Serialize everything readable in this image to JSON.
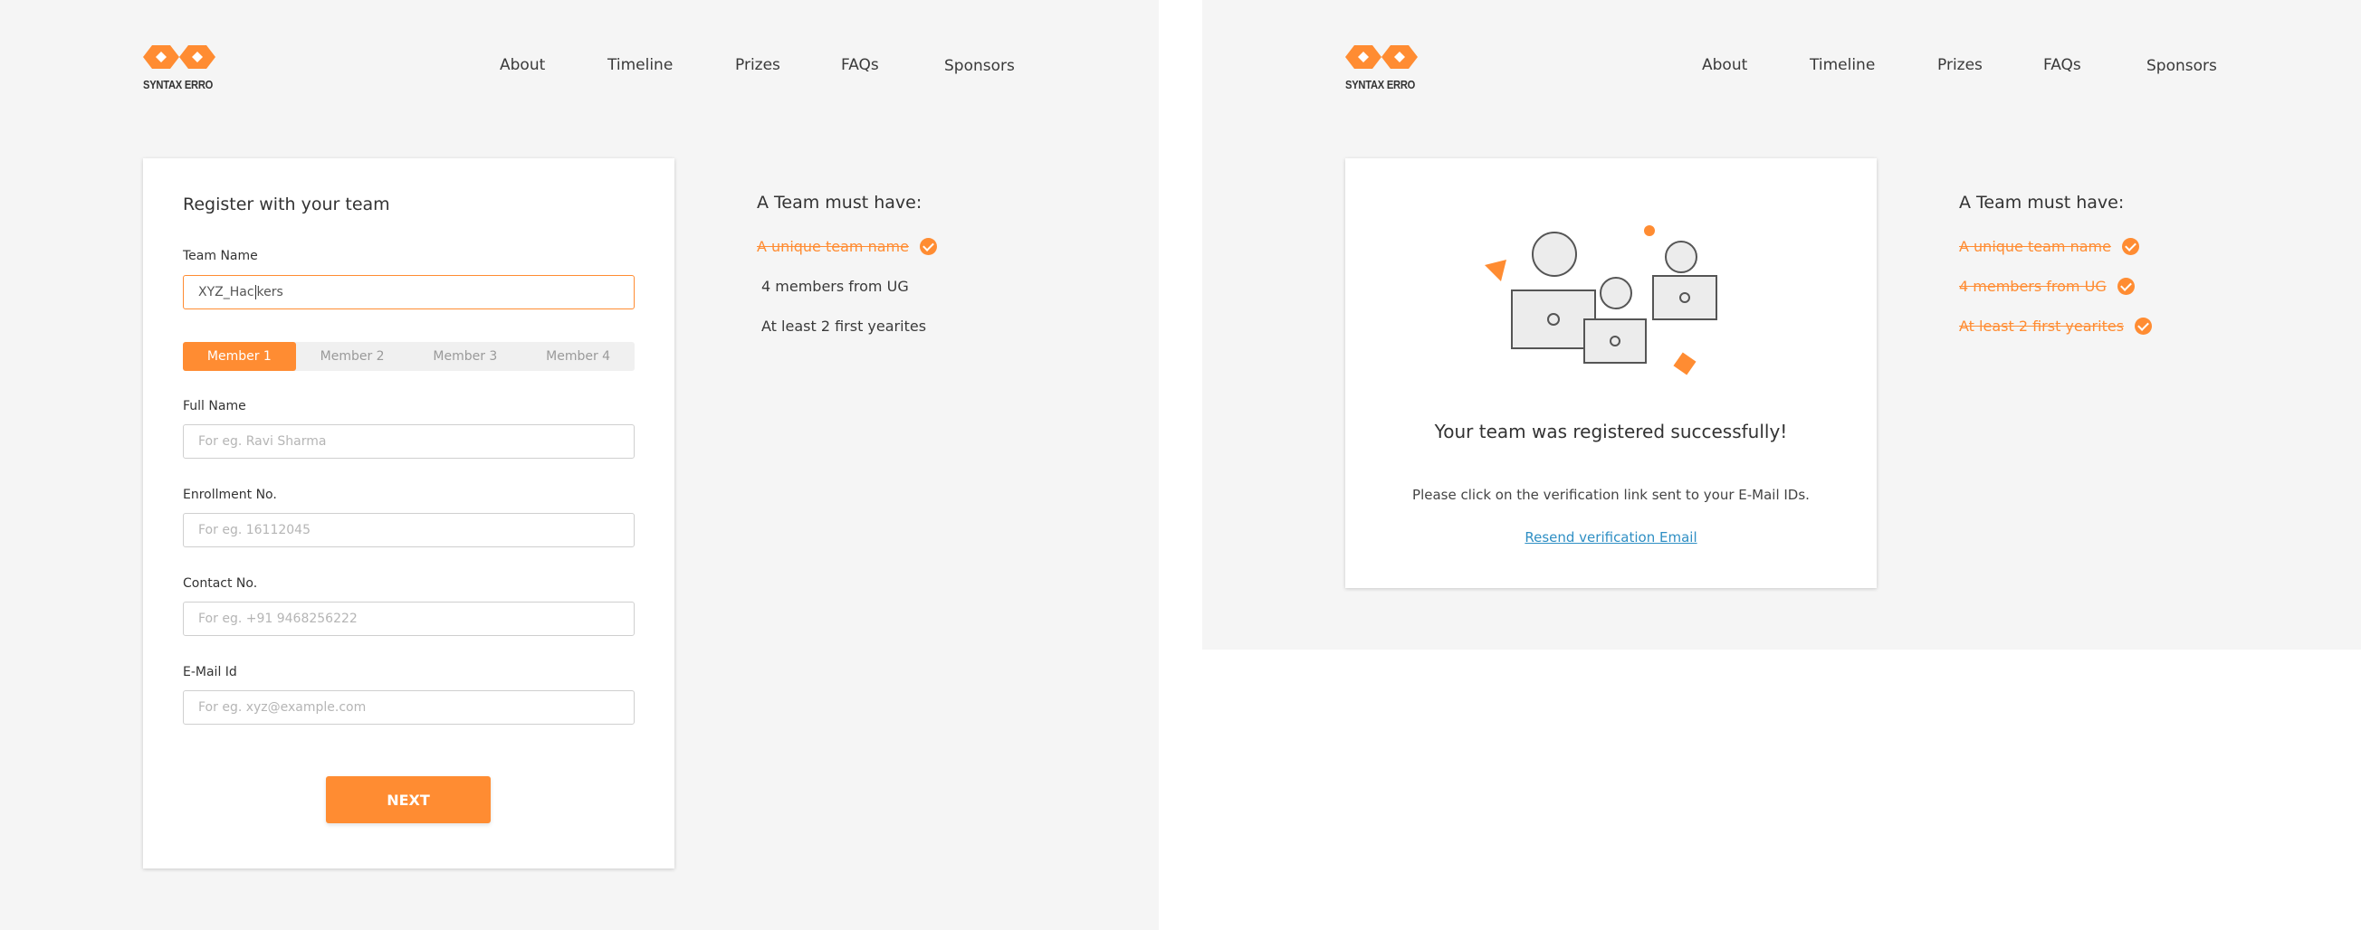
{
  "brand": {
    "name": "SYNTAX ERRO",
    "accent": "#ff8c32",
    "link_color": "#2f8fc4"
  },
  "nav": {
    "items": [
      "About",
      "Timeline",
      "Prizes",
      "FAQs",
      "Sponsors"
    ]
  },
  "registration": {
    "title": "Register with your team",
    "team_name_label": "Team Name",
    "team_name_value_before_caret": "XYZ_Hac",
    "team_name_value_after_caret": "kers",
    "member_tabs": [
      "Member 1",
      "Member 2",
      "Member 3",
      "Member 4"
    ],
    "active_tab": "Member 1",
    "full_name_label": "Full Name",
    "full_name_placeholder": "For eg. Ravi Sharma",
    "enrollment_label": "Enrollment No.",
    "enrollment_placeholder": "For eg. 16112045",
    "contact_label": "Contact No.",
    "contact_placeholder": "For eg. +91 9468256222",
    "email_label": "E-Mail Id",
    "email_placeholder": "For eg. xyz@example.com",
    "next_label": "NEXT"
  },
  "requirements_left": {
    "title": "A Team must have:",
    "items": [
      {
        "text": "A unique team name",
        "done": true
      },
      {
        "text": "4 members from UG",
        "done": false
      },
      {
        "text": "At least 2 first yearites",
        "done": false
      }
    ]
  },
  "success": {
    "message": "Your team was registered successfully!",
    "verify": "Please click on the verification link sent to your E-Mail IDs.",
    "resend": "Resend verification Email"
  },
  "requirements_right": {
    "title": "A Team must have:",
    "items": [
      {
        "text": "A unique team name",
        "done": true
      },
      {
        "text": "4 members from UG",
        "done": true
      },
      {
        "text": "At least 2 first yearites",
        "done": true
      }
    ]
  }
}
